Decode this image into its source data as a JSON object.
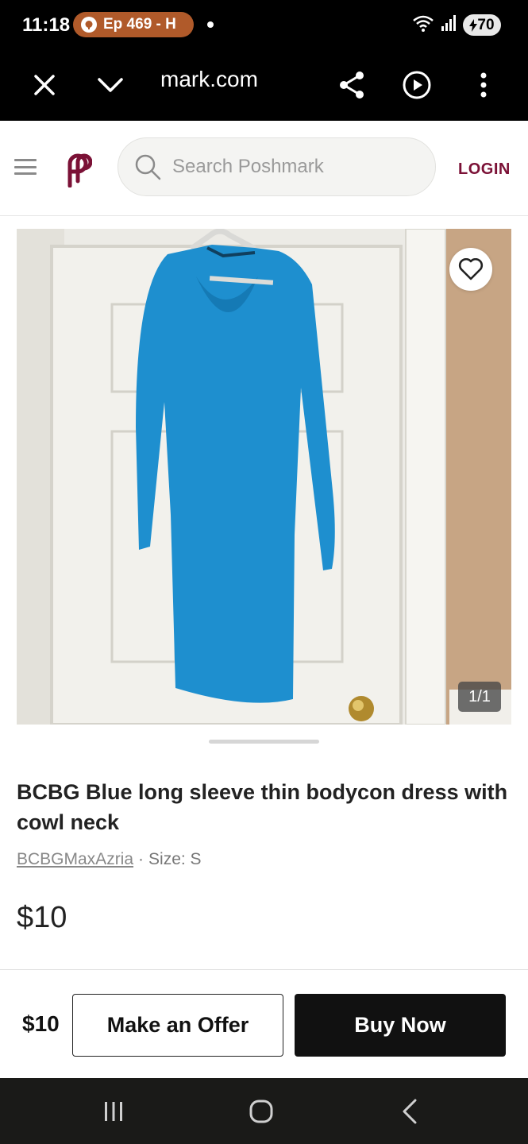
{
  "status_bar": {
    "time": "11:18",
    "notification_pill": "Ep 469 - H",
    "battery": "70"
  },
  "browser": {
    "url": "mark.com"
  },
  "header": {
    "search_placeholder": "Search Poshmark",
    "login_label": "LOGIN"
  },
  "listing": {
    "image_counter": "1/1",
    "title": "BCBG Blue long sleeve thin bodycon dress with cowl neck",
    "brand": "BCBGMaxAzria",
    "separator": "·",
    "size": "Size: S",
    "price": "$10"
  },
  "action_bar": {
    "price": "$10",
    "offer_label": "Make an Offer",
    "buy_label": "Buy Now"
  },
  "colors": {
    "brand": "#7b1136",
    "dress": "#1e8fcf",
    "status_pill": "#b05a2a"
  }
}
